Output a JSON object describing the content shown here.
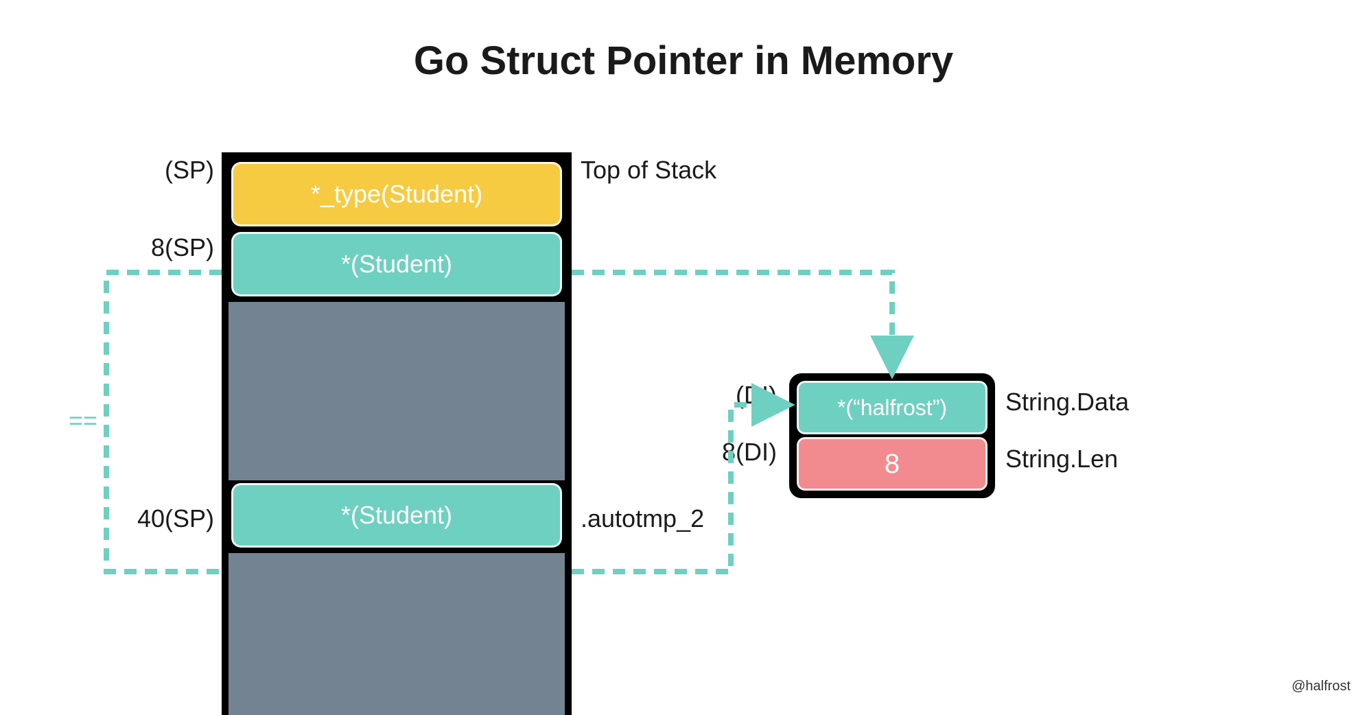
{
  "title": "Go Struct Pointer in Memory",
  "labels": {
    "top_of_stack": "Top of Stack",
    "sp": "(SP)",
    "sp8": "8(SP)",
    "sp40": "40(SP)",
    "autotmp": ".autotmp_2",
    "di": "(DI)",
    "di8": "8(DI)",
    "string_data": "String.Data",
    "string_len": "String.Len",
    "eq": "=="
  },
  "stack": {
    "cell0": "*_type(Student)",
    "cell1": "*(Student)",
    "cell3": "*(Student)"
  },
  "heap": {
    "data": "*(“halfrost”)",
    "len": "8"
  },
  "colors": {
    "teal": "#6ed0c0",
    "yellow": "#f6cb42",
    "red": "#f18b8f",
    "gray": "#748391"
  },
  "watermark": "@halfrost"
}
